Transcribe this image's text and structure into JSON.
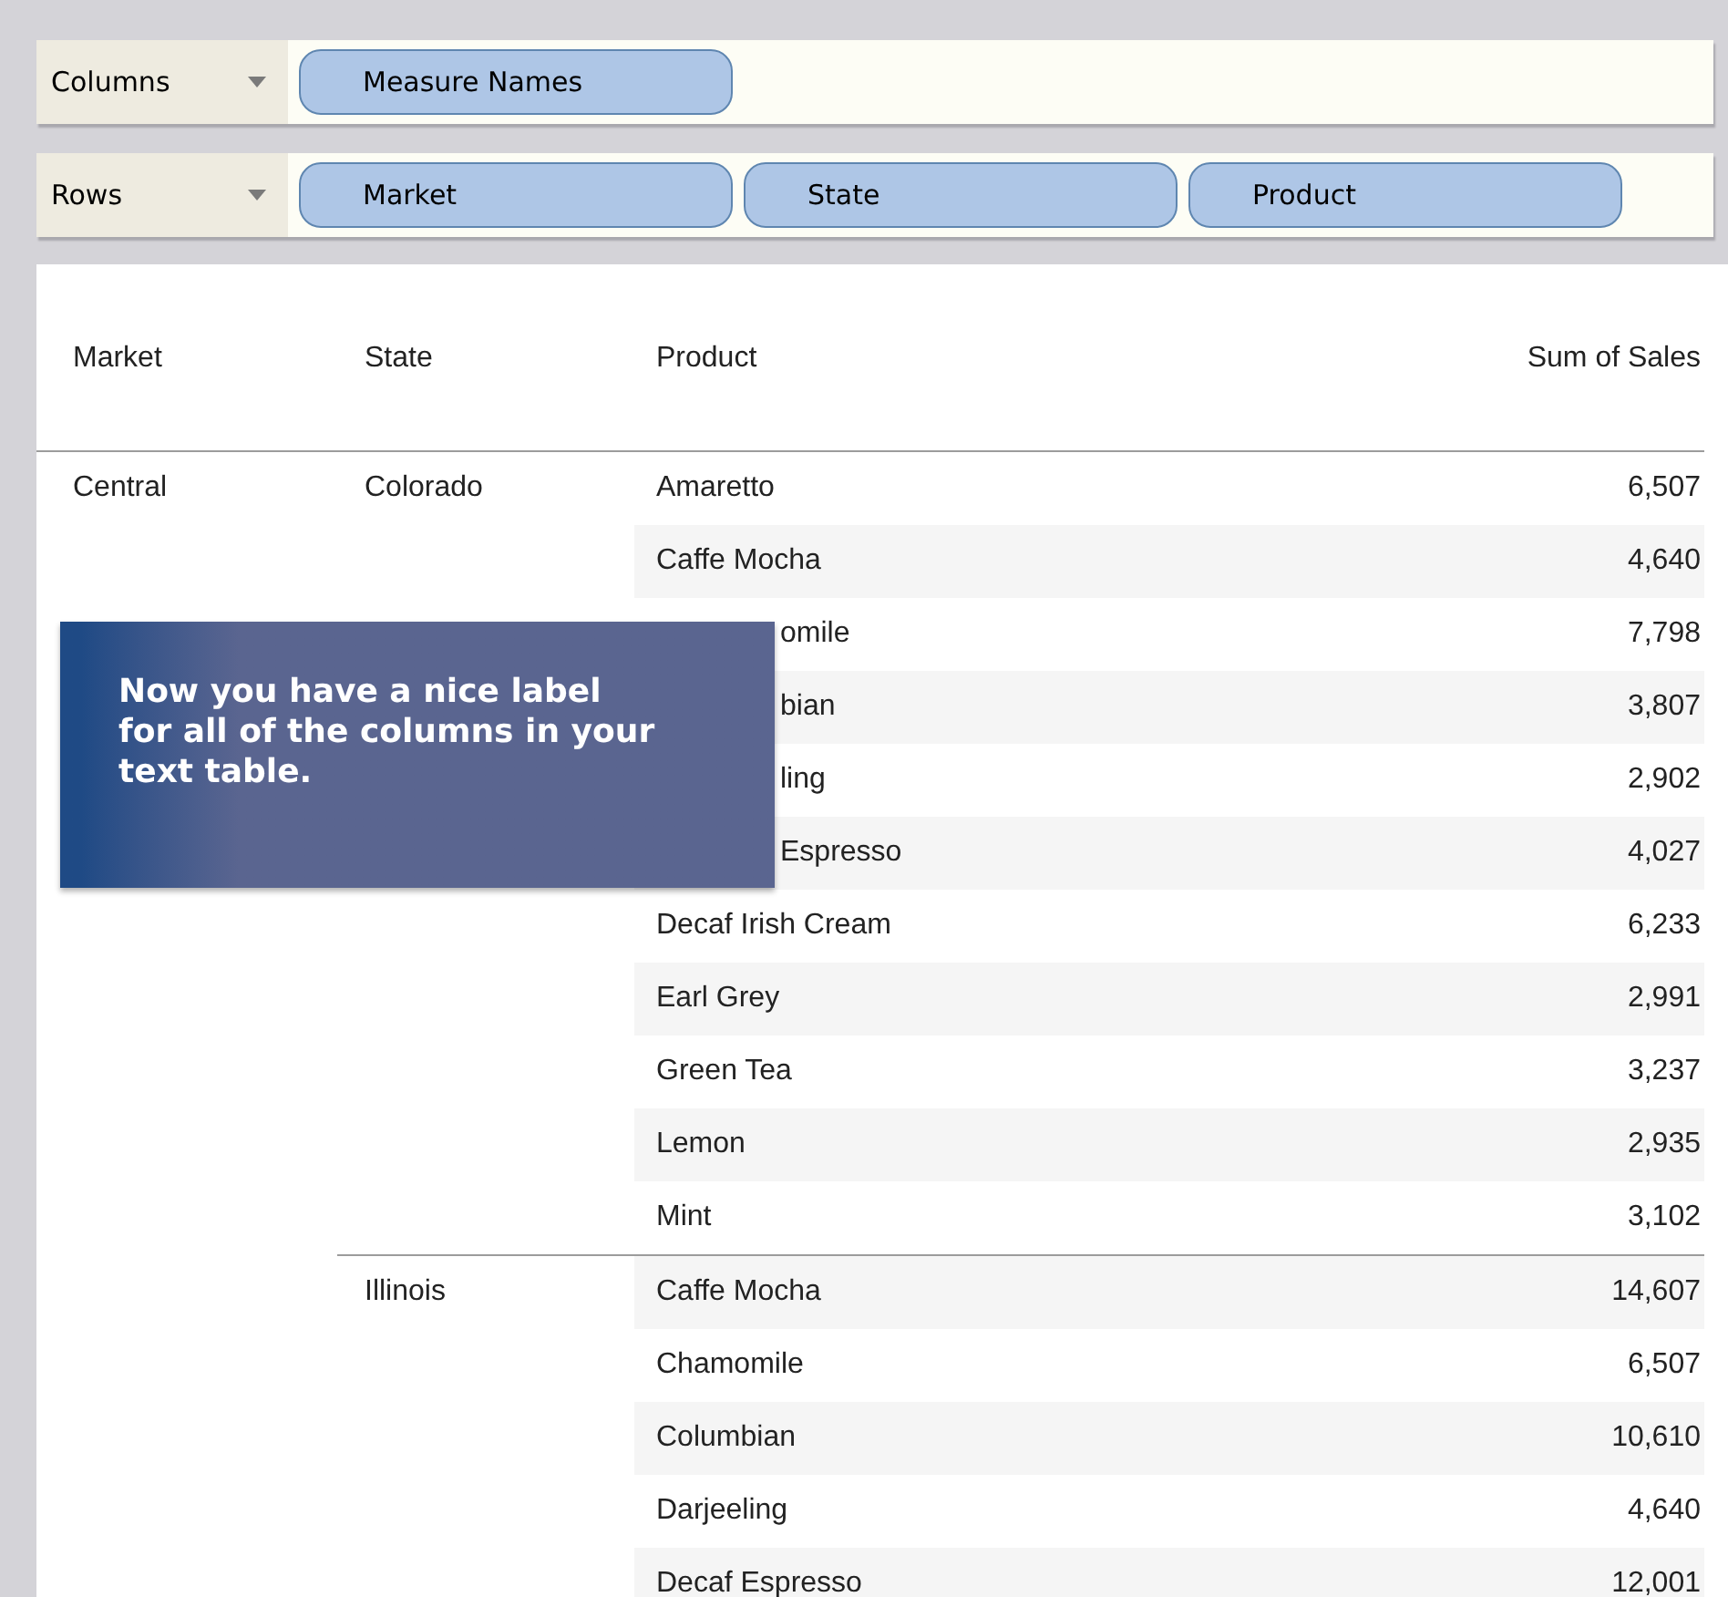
{
  "shelves": [
    {
      "label": "Columns",
      "pills": [
        "Measure Names"
      ]
    },
    {
      "label": "Rows",
      "pills": [
        "Market",
        "State",
        "Product"
      ]
    }
  ],
  "table": {
    "columns": [
      "Market",
      "State",
      "Product",
      "Sum of Sales"
    ],
    "markets": [
      {
        "name": "Central",
        "states": [
          {
            "name": "Colorado",
            "rows": [
              {
                "product": "Amaretto",
                "sales": "6,507",
                "partly_hidden": false
              },
              {
                "product": "Caffe Mocha",
                "sales": "4,640",
                "partly_hidden": false
              },
              {
                "product": "omile",
                "sales": "7,798",
                "partly_hidden": true
              },
              {
                "product": "bian",
                "sales": "3,807",
                "partly_hidden": true
              },
              {
                "product": "ling",
                "sales": "2,902",
                "partly_hidden": true
              },
              {
                "product": "Espresso",
                "sales": "4,027",
                "partly_hidden": true
              },
              {
                "product": "Decaf Irish Cream",
                "sales": "6,233",
                "partly_hidden": false
              },
              {
                "product": "Earl Grey",
                "sales": "2,991",
                "partly_hidden": false
              },
              {
                "product": "Green Tea",
                "sales": "3,237",
                "partly_hidden": false
              },
              {
                "product": "Lemon",
                "sales": "2,935",
                "partly_hidden": false
              },
              {
                "product": "Mint",
                "sales": "3,102",
                "partly_hidden": false
              }
            ]
          },
          {
            "name": "Illinois",
            "rows": [
              {
                "product": "Caffe Mocha",
                "sales": "14,607",
                "partly_hidden": false
              },
              {
                "product": "Chamomile",
                "sales": "6,507",
                "partly_hidden": false
              },
              {
                "product": "Columbian",
                "sales": "10,610",
                "partly_hidden": false
              },
              {
                "product": "Darjeeling",
                "sales": "4,640",
                "partly_hidden": false
              },
              {
                "product": "Decaf Espresso",
                "sales": "12,001",
                "partly_hidden": false
              }
            ]
          }
        ]
      }
    ]
  },
  "callout": {
    "text": "Now you have a nice label for all of the columns in your text table."
  }
}
